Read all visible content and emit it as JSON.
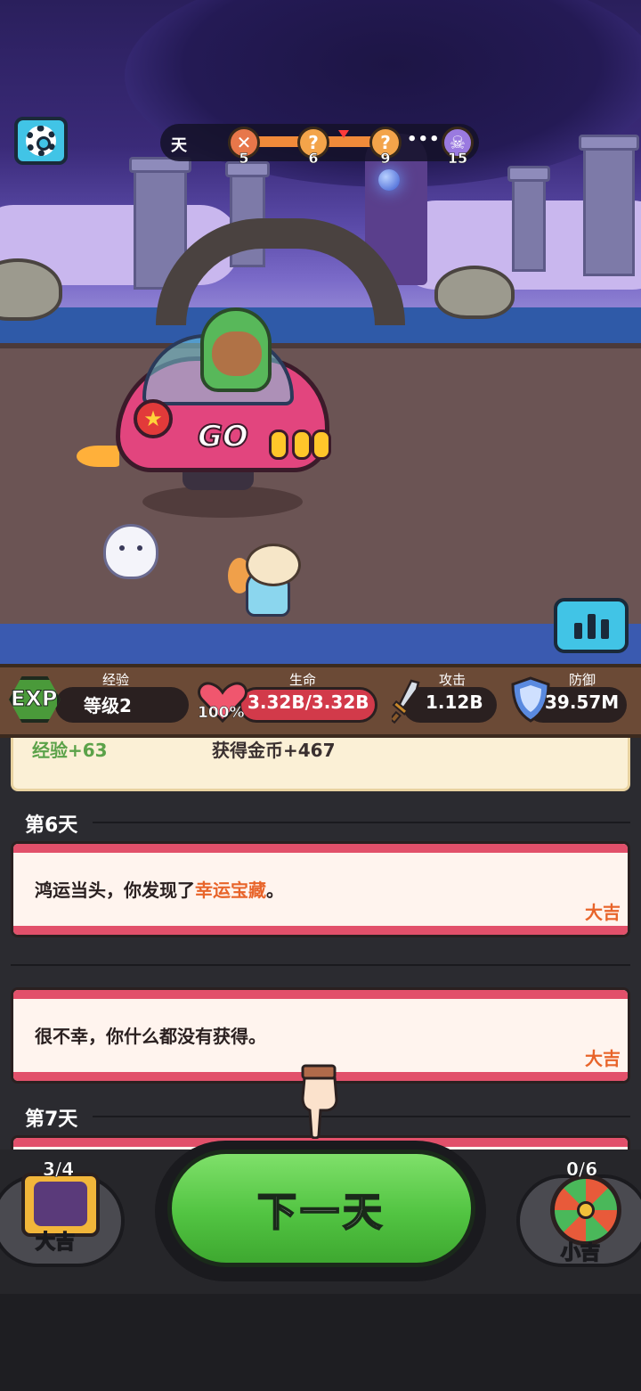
{
  "top_hud": {
    "day_label": "天",
    "nodes": [
      {
        "icon": "sword-crossed-icon",
        "number": "5"
      },
      {
        "icon": "question-icon",
        "glyph": "?",
        "number": "6"
      },
      {
        "icon": "question-icon",
        "glyph": "?",
        "number": "9"
      },
      {
        "icon": "skull-icon",
        "number": "15"
      }
    ],
    "dots": "•••"
  },
  "scene": {
    "vehicle_text": "GO"
  },
  "stats": {
    "exp": {
      "badge": "EXP",
      "label": "经验",
      "value": "等级2"
    },
    "hp": {
      "label": "生命",
      "percent": "100%",
      "value": "3.32B/3.32B"
    },
    "attack": {
      "label": "攻击",
      "value": "1.12B"
    },
    "defense": {
      "label": "防御",
      "value": "39.57M"
    }
  },
  "log": {
    "previous": {
      "exp_text": "经验+63",
      "coin_text": "获得金币+467"
    },
    "days": [
      {
        "header": "第6天",
        "events": [
          {
            "text_before": "鸿运当头，你发现了",
            "highlight": "幸运宝藏",
            "text_after": "。",
            "tag": "大吉"
          },
          {
            "text_before": "很不幸，你什么都没有获得。",
            "highlight": "",
            "text_after": "",
            "tag": "大吉"
          }
        ]
      },
      {
        "header": "第7天",
        "events": []
      }
    ]
  },
  "bottom": {
    "left": {
      "count": "3/4",
      "label": "大吉"
    },
    "next_day": "下一天",
    "right": {
      "count": "0/6",
      "label": "小吉"
    }
  },
  "colors": {
    "accent_green": "#52c442",
    "luck_orange": "#e8642a",
    "card_stripe": "#e2506a",
    "ui_cyan": "#41c4e6"
  }
}
